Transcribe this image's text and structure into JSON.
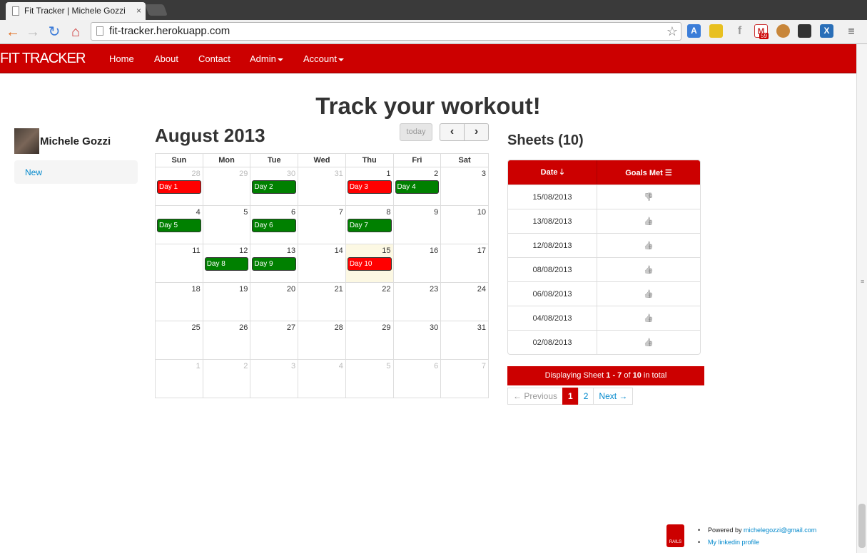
{
  "browser": {
    "tab_title": "Fit Tracker | Michele Gozzi",
    "tab_close": "×",
    "url": "fit-tracker.herokuapp.com",
    "gmail_count": "59"
  },
  "navbar": {
    "brand": "FIT TRACKER",
    "items": [
      "Home",
      "About",
      "Contact",
      "Admin",
      "Account"
    ]
  },
  "hero": "Track your workout!",
  "sidebar": {
    "user_name": "Michele Gozzi",
    "new_link": "New"
  },
  "calendar": {
    "title": "August 2013",
    "today_label": "today",
    "prev": "‹",
    "next": "›",
    "weekdays": [
      "Sun",
      "Mon",
      "Tue",
      "Wed",
      "Thu",
      "Fri",
      "Sat"
    ],
    "weeks": [
      [
        {
          "d": "28",
          "om": true,
          "ev": "Day 1",
          "c": "red"
        },
        {
          "d": "29",
          "om": true
        },
        {
          "d": "30",
          "om": true,
          "ev": "Day 2",
          "c": "green"
        },
        {
          "d": "31",
          "om": true
        },
        {
          "d": "1",
          "ev": "Day 3",
          "c": "red"
        },
        {
          "d": "2",
          "ev": "Day 4",
          "c": "green"
        },
        {
          "d": "3"
        }
      ],
      [
        {
          "d": "4",
          "ev": "Day 5",
          "c": "green"
        },
        {
          "d": "5"
        },
        {
          "d": "6",
          "ev": "Day 6",
          "c": "green"
        },
        {
          "d": "7"
        },
        {
          "d": "8",
          "ev": "Day 7",
          "c": "green"
        },
        {
          "d": "9"
        },
        {
          "d": "10"
        }
      ],
      [
        {
          "d": "11"
        },
        {
          "d": "12",
          "ev": "Day 8",
          "c": "green"
        },
        {
          "d": "13",
          "ev": "Day 9",
          "c": "green"
        },
        {
          "d": "14"
        },
        {
          "d": "15",
          "today": true,
          "ev": "Day 10",
          "c": "red"
        },
        {
          "d": "16"
        },
        {
          "d": "17"
        }
      ],
      [
        {
          "d": "18"
        },
        {
          "d": "19"
        },
        {
          "d": "20"
        },
        {
          "d": "21"
        },
        {
          "d": "22"
        },
        {
          "d": "23"
        },
        {
          "d": "24"
        }
      ],
      [
        {
          "d": "25"
        },
        {
          "d": "26"
        },
        {
          "d": "27"
        },
        {
          "d": "28"
        },
        {
          "d": "29"
        },
        {
          "d": "30"
        },
        {
          "d": "31"
        }
      ],
      [
        {
          "d": "1",
          "om": true
        },
        {
          "d": "2",
          "om": true
        },
        {
          "d": "3",
          "om": true
        },
        {
          "d": "4",
          "om": true
        },
        {
          "d": "5",
          "om": true
        },
        {
          "d": "6",
          "om": true
        },
        {
          "d": "7",
          "om": true
        }
      ]
    ]
  },
  "sheets": {
    "title": "Sheets (10)",
    "col_date": "Date",
    "col_goals": "Goals Met",
    "rows": [
      {
        "date": "15/08/2013",
        "goal": "down"
      },
      {
        "date": "13/08/2013",
        "goal": "up"
      },
      {
        "date": "12/08/2013",
        "goal": "up"
      },
      {
        "date": "08/08/2013",
        "goal": "up"
      },
      {
        "date": "06/08/2013",
        "goal": "up"
      },
      {
        "date": "04/08/2013",
        "goal": "up"
      },
      {
        "date": "02/08/2013",
        "goal": "up"
      }
    ],
    "info_prefix": "Displaying Sheet",
    "info_range": "1 - 7",
    "info_of": "of",
    "info_total": "10",
    "info_suffix": "in total",
    "pager": {
      "previous": "← Previous",
      "pages": [
        "1",
        "2"
      ],
      "next": "Next →"
    }
  },
  "footer": {
    "powered_by": "Powered by",
    "email": "michelegozzi@gmail.com",
    "linkedin": "My linkedin profile",
    "rails_label": "RAILS"
  },
  "colors": {
    "brand_red": "#cc0000",
    "event_red": "#ff0000",
    "event_green": "#008000",
    "today_bg": "#fcf8e3"
  }
}
